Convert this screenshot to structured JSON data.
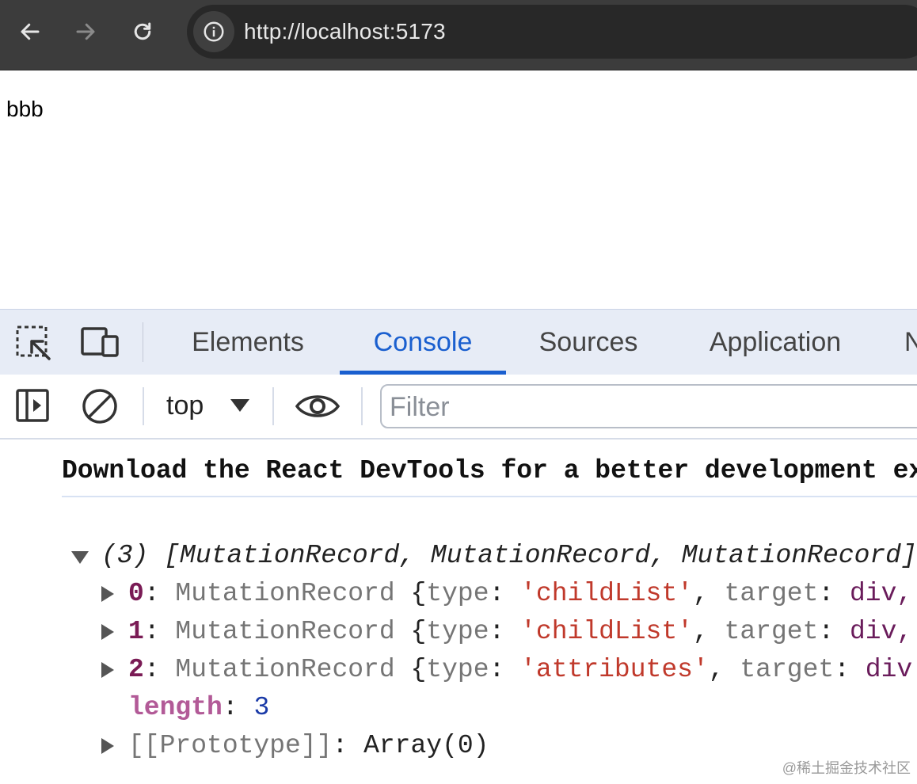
{
  "browser": {
    "url": "http://localhost:5173"
  },
  "page": {
    "body_text": "bbb"
  },
  "devtools": {
    "tabs": [
      {
        "label": "Elements"
      },
      {
        "label": "Console",
        "active": true
      },
      {
        "label": "Sources"
      },
      {
        "label": "Application"
      },
      {
        "label": "N"
      }
    ],
    "toolbar": {
      "context": "top",
      "filter_placeholder": "Filter"
    },
    "console": {
      "banner": "Download the React DevTools for a better development ex",
      "array_summary": {
        "count": "(3)",
        "text": "[MutationRecord, MutationRecord, MutationRecord]"
      },
      "entries": [
        {
          "index": "0",
          "cls": "MutationRecord",
          "type_key": "type",
          "type_value": "'childList'",
          "target_key": "target",
          "target_value": "div,"
        },
        {
          "index": "1",
          "cls": "MutationRecord",
          "type_key": "type",
          "type_value": "'childList'",
          "target_key": "target",
          "target_value": "div,"
        },
        {
          "index": "2",
          "cls": "MutationRecord",
          "type_key": "type",
          "type_value": "'attributes'",
          "target_key": "target",
          "target_value": "div"
        }
      ],
      "length": {
        "key": "length",
        "value": "3"
      },
      "prototype": {
        "key": "[[Prototype]]",
        "value": "Array(0)"
      }
    }
  },
  "watermark": "@稀土掘金技术社区"
}
